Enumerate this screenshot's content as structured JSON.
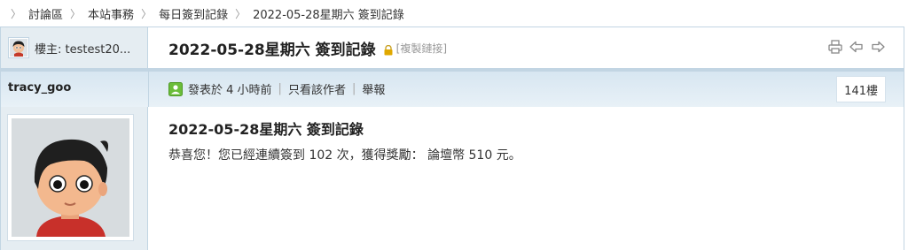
{
  "breadcrumb": {
    "items": [
      "討論區",
      "本站事務",
      "每日簽到記錄"
    ],
    "current": "2022-05-28星期六 簽到記錄",
    "separator": "〉"
  },
  "thread": {
    "host_label": "樓主: testest20...",
    "title": "2022-05-28星期六 簽到記錄",
    "copy_link_label": "[複製鏈接]"
  },
  "post": {
    "author": "tracy_goo",
    "posted_time": "發表於 4 小時前",
    "only_author_label": "只看該作者",
    "report_label": "舉報",
    "floor": "141樓",
    "title": "2022-05-28星期六 簽到記錄",
    "body": "恭喜您！您已經連續簽到 102 次，獲得獎勵： 論壇幣 510 元。"
  },
  "icons": {
    "lock": "lock-icon",
    "print": "print-icon",
    "prev": "prev-thread-icon",
    "next": "next-thread-icon",
    "online": "online-status-icon"
  },
  "colors": {
    "border": "#c2d5e3",
    "sidebar_bg": "#e5edf2",
    "lock": "#e0a800",
    "online": "#6bbd3a"
  }
}
